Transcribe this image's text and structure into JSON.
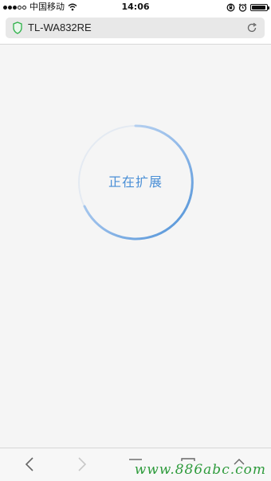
{
  "status_bar": {
    "carrier": "中国移动",
    "time": "14:06",
    "signal_bars_filled": 3,
    "signal_bars_total": 5
  },
  "address_bar": {
    "url_text": "TL-WA832RE",
    "secure_icon": "shield-icon",
    "reload_icon": "reload-icon"
  },
  "progress": {
    "label": "正在扩展",
    "accent_color": "#4a8fd6",
    "track_color": "#d9e6f5"
  },
  "toolbar": {
    "back_icon": "chevron-left-icon",
    "forward_icon": "chevron-right-icon",
    "share_icon": "share-icon",
    "bookmarks_icon": "book-icon",
    "tabs_icon": "tabs-icon"
  },
  "watermark": {
    "text": "www.886abc.com"
  }
}
